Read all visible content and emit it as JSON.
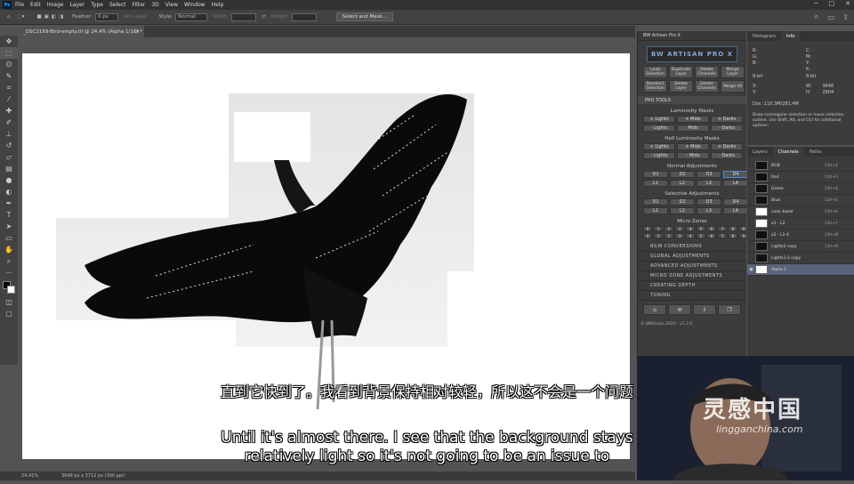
{
  "app": {
    "icon_label": "Ps"
  },
  "menu": [
    "File",
    "Edit",
    "Image",
    "Layer",
    "Type",
    "Select",
    "Filter",
    "3D",
    "View",
    "Window",
    "Help"
  ],
  "options": {
    "feather_label": "Feather:",
    "feather_value": "0 px",
    "antialias_label": "Anti-alias",
    "style_label": "Style:",
    "style_value": "Normal",
    "width_label": "Width:",
    "height_label": "Height:",
    "select_mask_label": "Select and Mask..."
  },
  "document": {
    "tab_title": "_DSC2169-Bird-empty.tif @ 24.4% (Alpha 1/16) *"
  },
  "status": {
    "zoom": "24.41%",
    "size": "3648 px x 3712 px (300 ppi)"
  },
  "toolkit": {
    "title": "BW Artisan Pro X",
    "logo": "BW ARTISAN PRO X",
    "top_buttons": [
      "Load Selection",
      "Duplicate Layer",
      "Delete Channels",
      "Merge Layer",
      "Deselect Selection",
      "Delete Layer",
      "Delete Channels",
      "Merge All"
    ],
    "pro_tools": "PRO TOOLS",
    "lum_title": "Luminosity Masks",
    "lum_buttons": [
      "+ Lights",
      "+ Mids",
      "+ Darks",
      "- Lights",
      "Mids",
      "- Darks"
    ],
    "half_title": "Half Luminosity Masks",
    "half_buttons": [
      "+ Lights",
      "+ Mids",
      "+ Darks",
      "- Lights",
      "- Mids",
      "- Darks"
    ],
    "normal_title": "Normal Adjustments",
    "normal_buttons": [
      "D1",
      "D2",
      "D3",
      "D4",
      "L1",
      "L2",
      "L3",
      "L4"
    ],
    "selective_title": "Selective Adjustments",
    "selective_buttons": [
      "D1",
      "D2",
      "D3",
      "D4",
      "L1",
      "L2",
      "L3",
      "L4"
    ],
    "micro_title": "Micro Zones",
    "micro_buttons": [
      "0",
      "1",
      "2",
      "3",
      "4",
      "5",
      "6",
      "7",
      "8",
      "9",
      "0",
      "1",
      "2",
      "3",
      "4",
      "5",
      "6",
      "7",
      "8",
      "9"
    ],
    "sections": [
      "B&W CONVERSIONS",
      "GLOBAL ADJUSTMENTS",
      "ADVANCED ADJUSTMENTS",
      "MICRO ZONE ADJUSTMENTS",
      "CREATING DEPTH",
      "TONING"
    ],
    "credit": "© BWVision 2020 - v1.3.0"
  },
  "info": {
    "tabs": [
      "Histogram",
      "Info"
    ],
    "rgb": [
      "R:",
      "G:",
      "B:"
    ],
    "cmyk": [
      "C:",
      "M:",
      "Y:",
      "K:"
    ],
    "bits_left": "8-bit",
    "bits_right": "8-bit",
    "x_label": "X:",
    "y_label": "Y:",
    "w_label": "W:",
    "h_label": "H:",
    "w_value": "3648",
    "h_value": "2804",
    "doc": "Doc: 110.3M/281.4M",
    "hint": "Draw rectangular selection or move selection outline. Use Shift, Alt, and Ctrl for additional options."
  },
  "channels": {
    "tabs": [
      "Layers",
      "Channels",
      "Paths"
    ],
    "items": [
      {
        "name": "RGB",
        "shortcut": "Ctrl+2"
      },
      {
        "name": "Red",
        "shortcut": "Ctrl+3"
      },
      {
        "name": "Green",
        "shortcut": "Ctrl+4"
      },
      {
        "name": "Blue",
        "shortcut": "Ctrl+5"
      },
      {
        "name": "color basel",
        "shortcut": "Ctrl+6"
      },
      {
        "name": "x1 - L2",
        "shortcut": "Ctrl+7"
      },
      {
        "name": "x2 - L1-4",
        "shortcut": "Ctrl+8"
      },
      {
        "name": "Lights2 copy",
        "shortcut": "Ctrl+9"
      },
      {
        "name": "Lights1-2 copy",
        "shortcut": ""
      },
      {
        "name": "Alpha 1",
        "shortcut": ""
      }
    ]
  },
  "subtitles": {
    "zh": "直到它快到了。我看到背景保持相对较轻，所以这不会是一个问题",
    "en1": "Until it's almost there. I see that the background stays",
    "en2": "relatively light so it's not going to be an issue to"
  },
  "watermark": {
    "cn": "灵感中国",
    "url": "lingganchina.com"
  }
}
